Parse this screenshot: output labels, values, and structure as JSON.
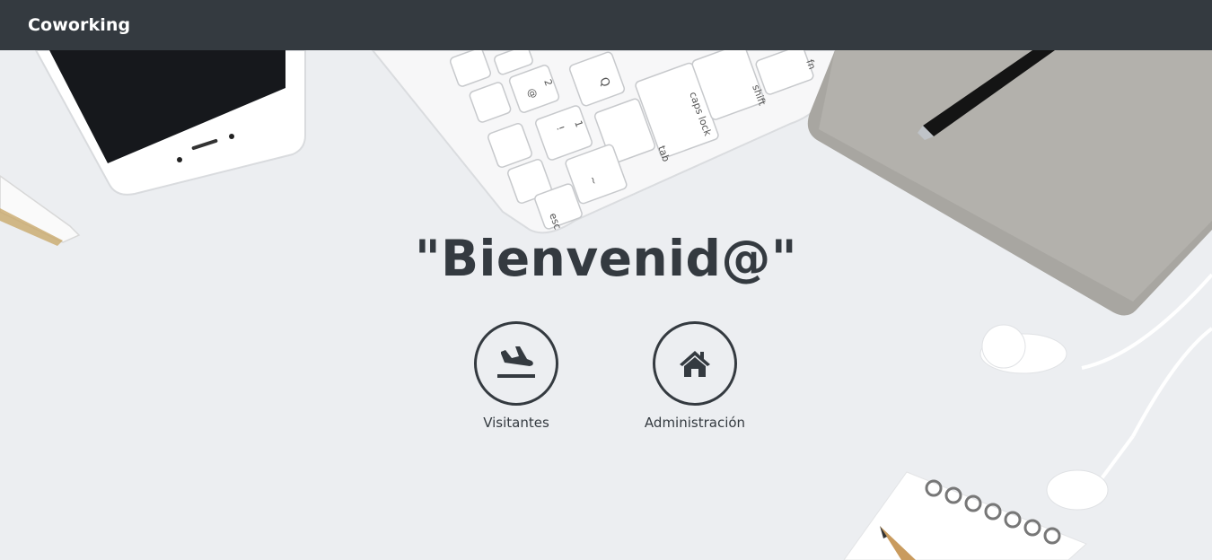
{
  "navbar": {
    "brand": "Coworking"
  },
  "hero": {
    "title": "\"Bienvenid@\"",
    "options": [
      {
        "label": "Visitantes",
        "icon": "plane-arrival-icon"
      },
      {
        "label": "Administración",
        "icon": "home-icon"
      }
    ]
  },
  "keyboard": {
    "keys": [
      "shift",
      "caps lock",
      "tab",
      "esc",
      "@",
      "2",
      "Q",
      "!",
      "1",
      "~",
      "fn"
    ]
  },
  "colors": {
    "navbar": "#343a40",
    "text": "#343a40",
    "background": "#eceef1"
  }
}
